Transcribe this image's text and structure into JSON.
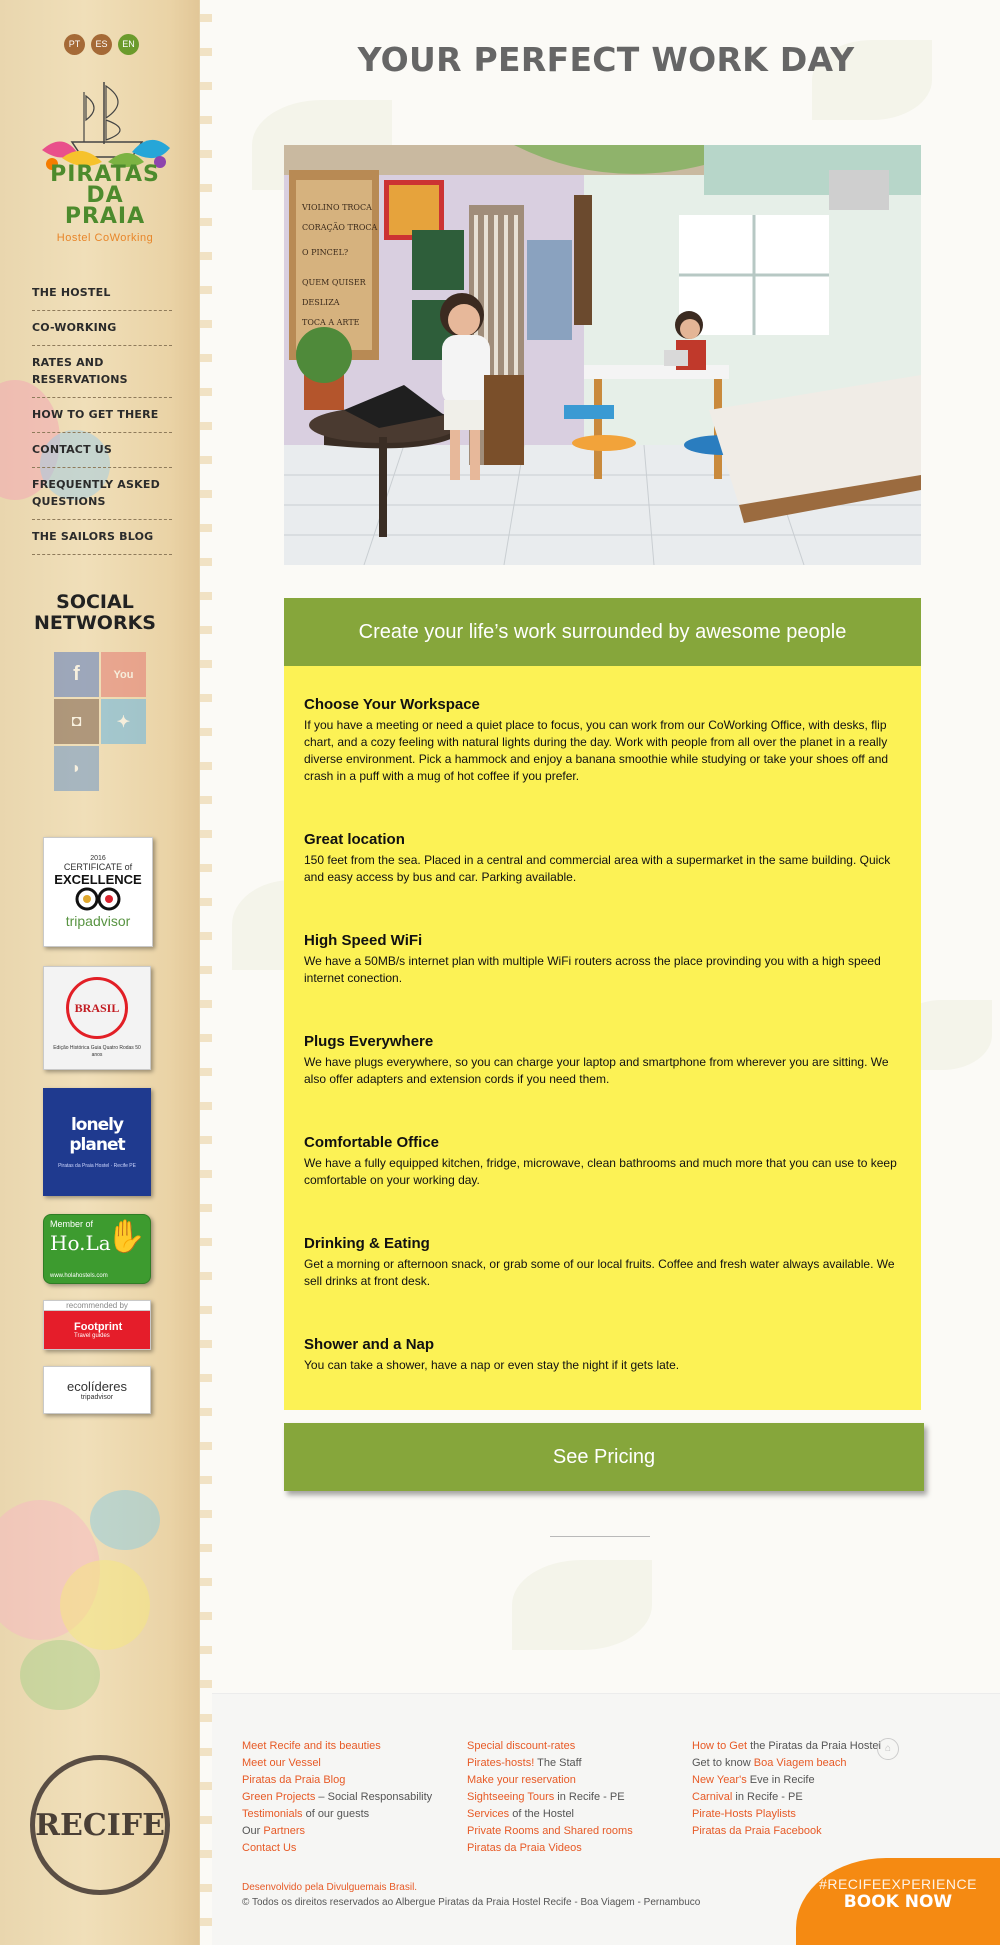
{
  "languages": [
    "PT",
    "ES",
    "EN"
  ],
  "colors": {
    "green": "#86a63b",
    "yellow": "#fcf255",
    "orange_link": "#e75a26",
    "book_orange": "#f58a12"
  },
  "logo": {
    "title": "PIRATAS DA PRAIA",
    "subtitle": "Hostel CoWorking"
  },
  "nav": [
    "THE HOSTEL",
    "CO-WORKING",
    "RATES AND RESERVATIONS",
    "HOW TO GET THERE",
    "CONTACT US",
    "FREQUENTLY ASKED QUESTIONS",
    "THE SAILORS BLOG"
  ],
  "social": {
    "title": "SOCIAL NETWORKS",
    "icons": [
      "facebook-icon",
      "youtube-icon",
      "instagram-icon",
      "twitter-icon",
      "rss-icon"
    ]
  },
  "badges": {
    "tripadvisor": {
      "year": "2016",
      "line1": "CERTIFICATE of",
      "line2": "EXCELLENCE",
      "brand": "tripadvisor"
    },
    "quatro_rodas": {
      "brand": "BRASIL",
      "caption": "Edição Histórica Guia Quatro Rodas 50 anos"
    },
    "lonely_planet": {
      "brand": "lonely planet",
      "caption": "Piratas da Praia Hostel · Recife PE"
    },
    "hola": {
      "top": "Member of",
      "brand": "Ho.La",
      "url": "www.holahostels.com"
    },
    "footprint": {
      "top": "recommended by",
      "brand": "Footprint",
      "sub": "Travel guides"
    },
    "ecolideres": {
      "brand": "ecolíderes",
      "sub": "tripadvisor"
    }
  },
  "stamp": "RECIFE",
  "main": {
    "title": "YOUR PERFECT WORK DAY",
    "card_heading": "Create your life’s work surrounded by awesome people",
    "features": [
      {
        "title": "Choose Your Workspace",
        "text": "If you have a meeting or need a quiet place to focus, you can work from our CoWorking Office, with desks, flip chart, and a cozy feeling with natural lights during the day. Work with people from all over the planet in a really diverse environment. Pick a hammock and enjoy a banana smoothie while studying or take your shoes off and crash in a puff with a mug of hot coffee if you prefer."
      },
      {
        "title": "Great location",
        "text": "150 feet from the sea. Placed in a central and commercial area with a supermarket in the same building. Quick and easy access by bus and car. Parking available."
      },
      {
        "title": "High Speed WiFi",
        "text": "We have a 50MB/s internet plan with multiple WiFi routers across the place provinding you with a high speed internet conection."
      },
      {
        "title": "Plugs Everywhere",
        "text": "We have plugs everywhere, so you can charge your laptop and smartphone from wherever you are sitting. We also offer adapters and extension cords if you need them."
      },
      {
        "title": "Comfortable Office",
        "text": "We have a fully equipped kitchen, fridge, microwave, clean bathrooms and much more that you can use to keep comfortable on your working day."
      },
      {
        "title": "Drinking & Eating",
        "text": "Get a morning or afternoon snack, or grab some of our local fruits. Coffee and fresh water always available. We sell drinks at front desk."
      },
      {
        "title": "Shower and a Nap",
        "text": "You can take a shower, have a nap or even stay the night if it gets late."
      }
    ],
    "cta": "See Pricing",
    "photo_board_text": [
      "VIOLINO TROCA",
      "CORAÇÃO TROCA",
      "O PINCEL?",
      "QUEM QUISER",
      "DESLIZA",
      "TOCA A ARTE"
    ]
  },
  "footer": {
    "col1": [
      {
        "a": "Meet Recife and its beauties",
        "b": ""
      },
      {
        "a": "Meet our Vessel",
        "b": ""
      },
      {
        "a": "Piratas da Praia Blog",
        "b": ""
      },
      {
        "a": "Green Projects",
        "b": " – Social Responsability"
      },
      {
        "a": "Testimonials",
        "b": " of our guests"
      },
      {
        "pre": "Our ",
        "a": "Partners",
        "b": ""
      },
      {
        "a": "Contact Us",
        "b": ""
      }
    ],
    "col2": [
      {
        "a": "Special discount-rates",
        "b": ""
      },
      {
        "a": "Pirates-hosts!",
        "b": " The Staff"
      },
      {
        "a": "Make your reservation",
        "b": ""
      },
      {
        "a": "Sightseeing Tours",
        "b": " in Recife - PE"
      },
      {
        "a": "Services",
        "b": " of the Hostel"
      },
      {
        "a": "Private Rooms and Shared rooms",
        "b": ""
      },
      {
        "a": "Piratas da Praia Videos",
        "b": ""
      }
    ],
    "col3": [
      {
        "a": "How to Get",
        "b": " the Piratas da Praia Hostel"
      },
      {
        "pre": "Get to know ",
        "a": "Boa Viagem beach",
        "b": ""
      },
      {
        "a": "New Year's",
        "b": " Eve in Recife"
      },
      {
        "a": "Carnival",
        "b": " in Recife - PE"
      },
      {
        "a": "Pirate-Hosts Playlists",
        "b": ""
      },
      {
        "a": "Piratas da Praia Facebook",
        "b": ""
      }
    ],
    "developer": "Desenvolvido pela Divulguemais Brasil.",
    "copyright": "© Todos os direitos reservados ao Albergue Piratas da Praia Hostel Recife - Boa Viagem - Pernambuco"
  },
  "book": {
    "tag": "#RECIFEEXPERIENCE",
    "label": "BOOK NOW"
  }
}
